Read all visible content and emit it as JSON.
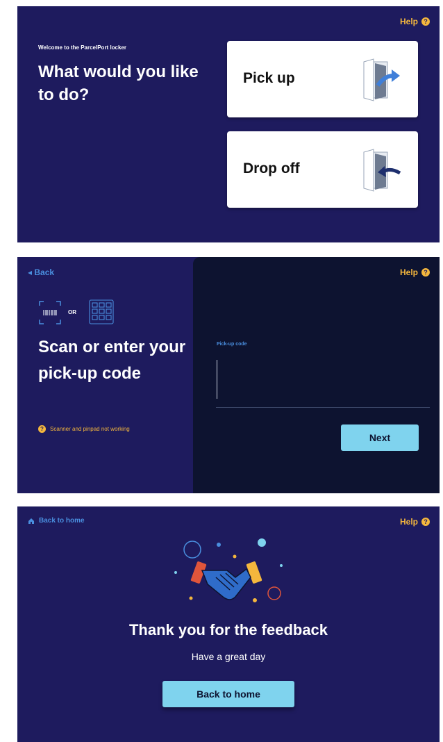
{
  "help_label": "Help",
  "help_glyph": "?",
  "screen1": {
    "welcome": "Welcome to the ParcelPort locker",
    "title": "What would you like to do?",
    "pickup_label": "Pick up",
    "dropoff_label": "Drop off"
  },
  "screen2": {
    "back_arrow": "◂",
    "back_label": "Back",
    "or_label": "OR",
    "title": "Scan or enter your pick-up code",
    "not_working": "Scanner and pinpad not working",
    "code_label": "Pick-up code",
    "code_value": "",
    "next_label": "Next"
  },
  "screen3": {
    "home_link": "Back to home",
    "title": "Thank you for the feedback",
    "subtitle": "Have a great day",
    "button_label": "Back to home"
  },
  "colors": {
    "panel_bg": "#1e1b5e",
    "dark_bg": "#0d1330",
    "accent_yellow": "#f4b73d",
    "accent_blue": "#4a8fdf",
    "button_cyan": "#7fd3ee"
  },
  "icons": [
    "help-icon",
    "door-out-icon",
    "door-in-icon",
    "barcode-icon",
    "keypad-icon",
    "home-icon",
    "handshake-illustration"
  ]
}
